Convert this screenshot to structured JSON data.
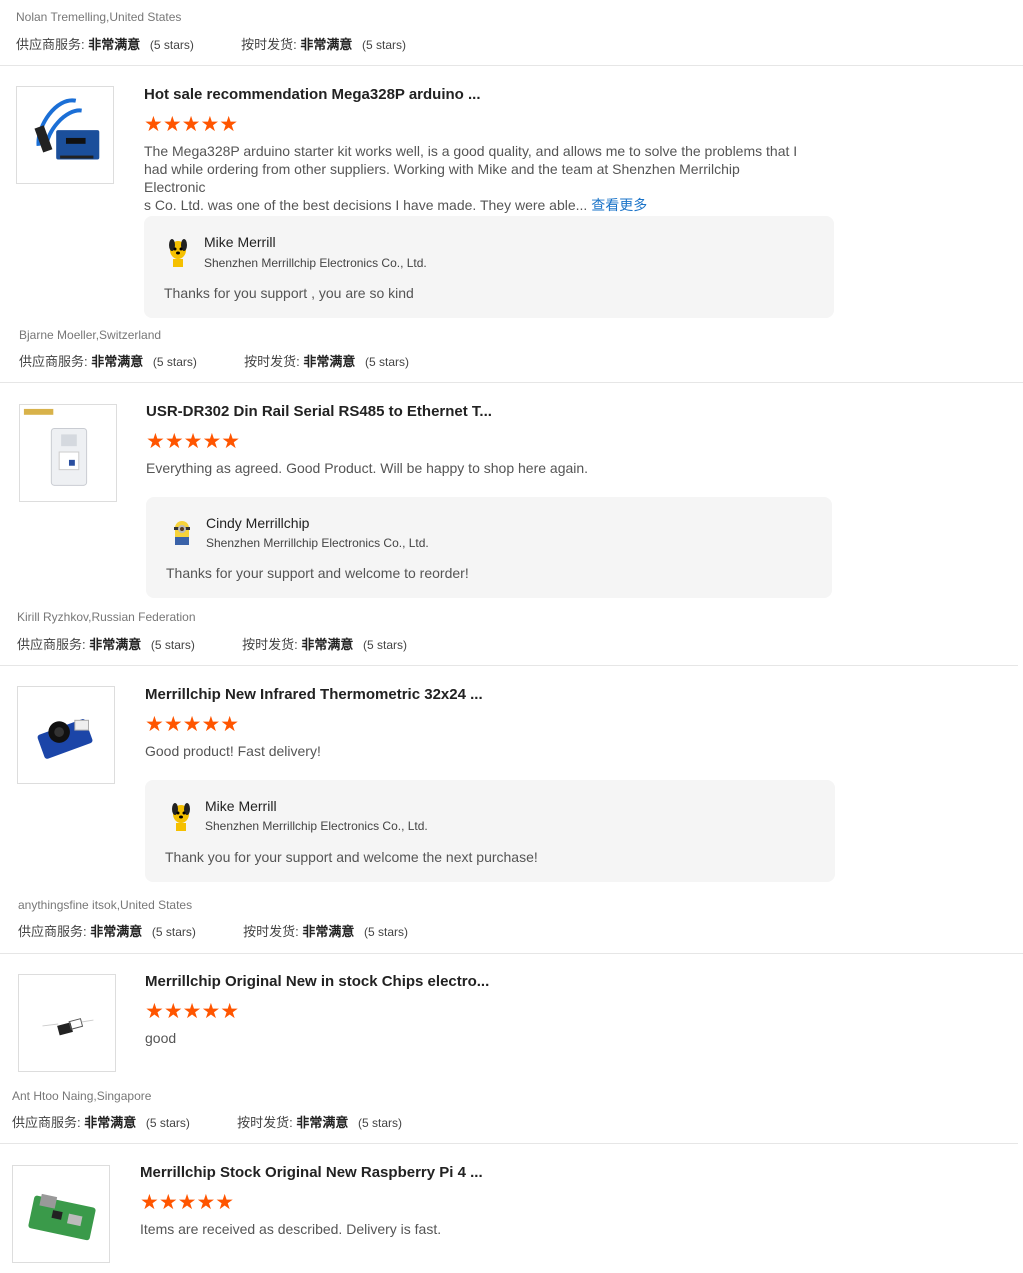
{
  "top_review": {
    "reviewer": "Nolan Tremelling,United States",
    "ratings": {
      "service_label": "供应商服务:",
      "service_value": "非常满意",
      "service_stars": "(5 stars)",
      "ship_label": "按时发货:",
      "ship_value": "非常满意",
      "ship_stars": "(5 stars)"
    }
  },
  "reviews": [
    {
      "product_title": "Hot sale recommendation Mega328P arduino ...",
      "stars": "★★★★★",
      "text_lines": [
        "The Mega328P arduino starter kit works well, is a good quality, and allows me to solve the problems that I",
        "had while ordering from other suppliers. Working with Mike and the team at Shenzhen Merrilchip Electronic",
        "s Co. Ltd. was one of the best decisions I have made. They were able..."
      ],
      "more": "查看更多",
      "reply": {
        "name": "Mike Merrill",
        "company": "Shenzhen Merrillchip Electronics Co., Ltd.",
        "message": "Thanks for you support ,  you are so kind",
        "avatar_icon": "dog-cartoon-avatar-icon"
      },
      "reviewer": "Bjarne Moeller,Switzerland",
      "ratings": {
        "service_label": "供应商服务:",
        "service_value": "非常满意",
        "service_stars": "(5 stars)",
        "ship_label": "按时发货:",
        "ship_value": "非常满意",
        "ship_stars": "(5 stars)"
      }
    },
    {
      "product_title": "USR-DR302 Din Rail Serial RS485 to Ethernet T...",
      "stars": "★★★★★",
      "text_lines": [
        "Everything as agreed. Good Product. Will be happy to shop here again."
      ],
      "reply": {
        "name": "Cindy Merrillchip",
        "company": "Shenzhen Merrillchip Electronics Co., Ltd.",
        "message": "Thanks for your support and welcome to reorder!",
        "avatar_icon": "minion-avatar-icon"
      },
      "reviewer": "Kirill Ryzhkov,Russian Federation",
      "ratings": {
        "service_label": "供应商服务:",
        "service_value": "非常满意",
        "service_stars": "(5 stars)",
        "ship_label": "按时发货:",
        "ship_value": "非常满意",
        "ship_stars": "(5 stars)"
      }
    },
    {
      "product_title": "Merrillchip New Infrared Thermometric 32x24 ...",
      "stars": "★★★★★",
      "text_lines": [
        "Good product! Fast delivery!"
      ],
      "reply": {
        "name": "Mike Merrill",
        "company": "Shenzhen Merrillchip Electronics Co., Ltd.",
        "message": "Thank you for your support and welcome the next purchase!",
        "avatar_icon": "dog-cartoon-avatar-icon"
      },
      "reviewer": "anythingsfine itsok,United States",
      "ratings": {
        "service_label": "供应商服务:",
        "service_value": "非常满意",
        "service_stars": "(5 stars)",
        "ship_label": "按时发货:",
        "ship_value": "非常满意",
        "ship_stars": "(5 stars)"
      }
    },
    {
      "product_title": "Merrillchip Original New in stock Chips electro...",
      "stars": "★★★★★",
      "text_lines": [
        "good"
      ],
      "reviewer": "Ant Htoo Naing,Singapore",
      "ratings": {
        "service_label": "供应商服务:",
        "service_value": "非常满意",
        "service_stars": "(5 stars)",
        "ship_label": "按时发货:",
        "ship_value": "非常满意",
        "ship_stars": "(5 stars)"
      }
    },
    {
      "product_title": "Merrillchip Stock Original New Raspberry Pi 4 ...",
      "stars": "★★★★★",
      "text_lines": [
        "Items are received as described.  Delivery is fast."
      ]
    }
  ],
  "colors": {
    "star": "#ff5500",
    "link": "#1a73c8",
    "reply_bg": "#f5f5f5"
  }
}
